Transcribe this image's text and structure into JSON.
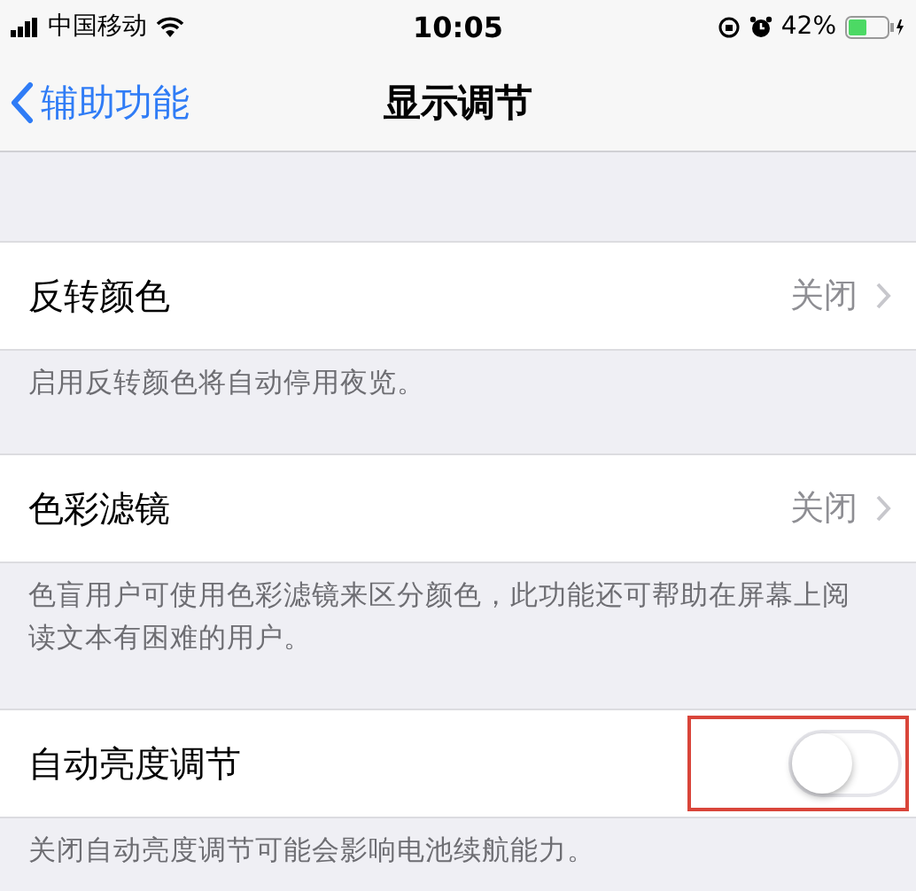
{
  "status_bar": {
    "carrier": "中国移动",
    "time": "10:05",
    "battery": "42%"
  },
  "nav": {
    "back": "辅助功能",
    "title": "显示调节"
  },
  "groups": [
    {
      "row": {
        "kind": "disclosure",
        "label": "反转颜色",
        "value": "关闭",
        "highlighted": false
      },
      "footer": "启用反转颜色将自动停用夜览。"
    },
    {
      "row": {
        "kind": "disclosure",
        "label": "色彩滤镜",
        "value": "关闭",
        "highlighted": false
      },
      "footer": "色盲用户可使用色彩滤镜来区分颜色，此功能还可帮助在屏幕上阅读文本有困难的用户。"
    },
    {
      "row": {
        "kind": "toggle",
        "label": "自动亮度调节",
        "on": false,
        "highlighted": true
      },
      "footer": "关闭自动亮度调节可能会影响电池续航能力。"
    }
  ]
}
